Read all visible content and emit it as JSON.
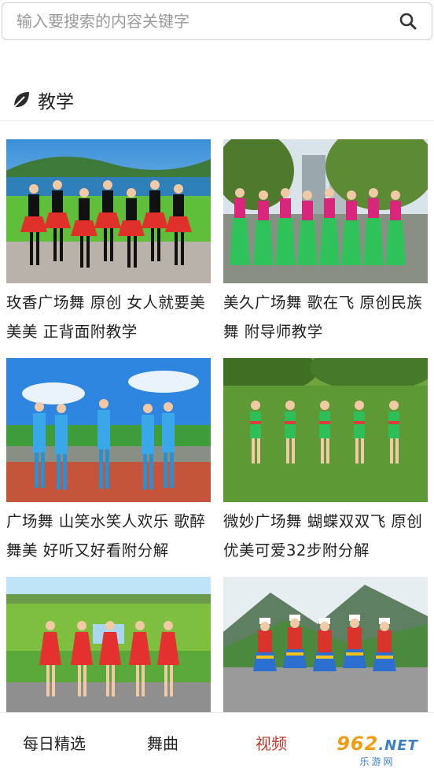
{
  "search": {
    "placeholder": "输入要搜索的内容关键字",
    "icon": "search-icon"
  },
  "section": {
    "icon": "leaf-icon",
    "title": "教学"
  },
  "videos": [
    {
      "title": "玫香广场舞 原创 女人就要美美美 正背面附教学",
      "scene": "lake-dance-red"
    },
    {
      "title": "美久广场舞 歌在飞 原创民族舞 附导师教学",
      "scene": "park-dance-pink"
    },
    {
      "title": "广场舞 山笑水笑人欢乐 歌醉舞美 好听又好看附分解",
      "scene": "plaza-dance-blue"
    },
    {
      "title": "微妙广场舞 蝴蝶双双飞 原创优美可爱32步附分解",
      "scene": "field-dance-green"
    },
    {
      "title": "",
      "scene": "meadow-dance-red"
    },
    {
      "title": "",
      "scene": "mountain-dance-ethnic"
    }
  ],
  "bottom_nav": [
    {
      "label": "每日精选",
      "active": false
    },
    {
      "label": "舞曲",
      "active": false
    },
    {
      "label": "视频",
      "active": true
    },
    {
      "label": "",
      "active": false
    }
  ],
  "watermark": {
    "top": "962",
    "net": ".NET",
    "bottom": "乐游网"
  },
  "colors": {
    "active_tab": "#c0392b",
    "border": "#cfcfcf"
  }
}
